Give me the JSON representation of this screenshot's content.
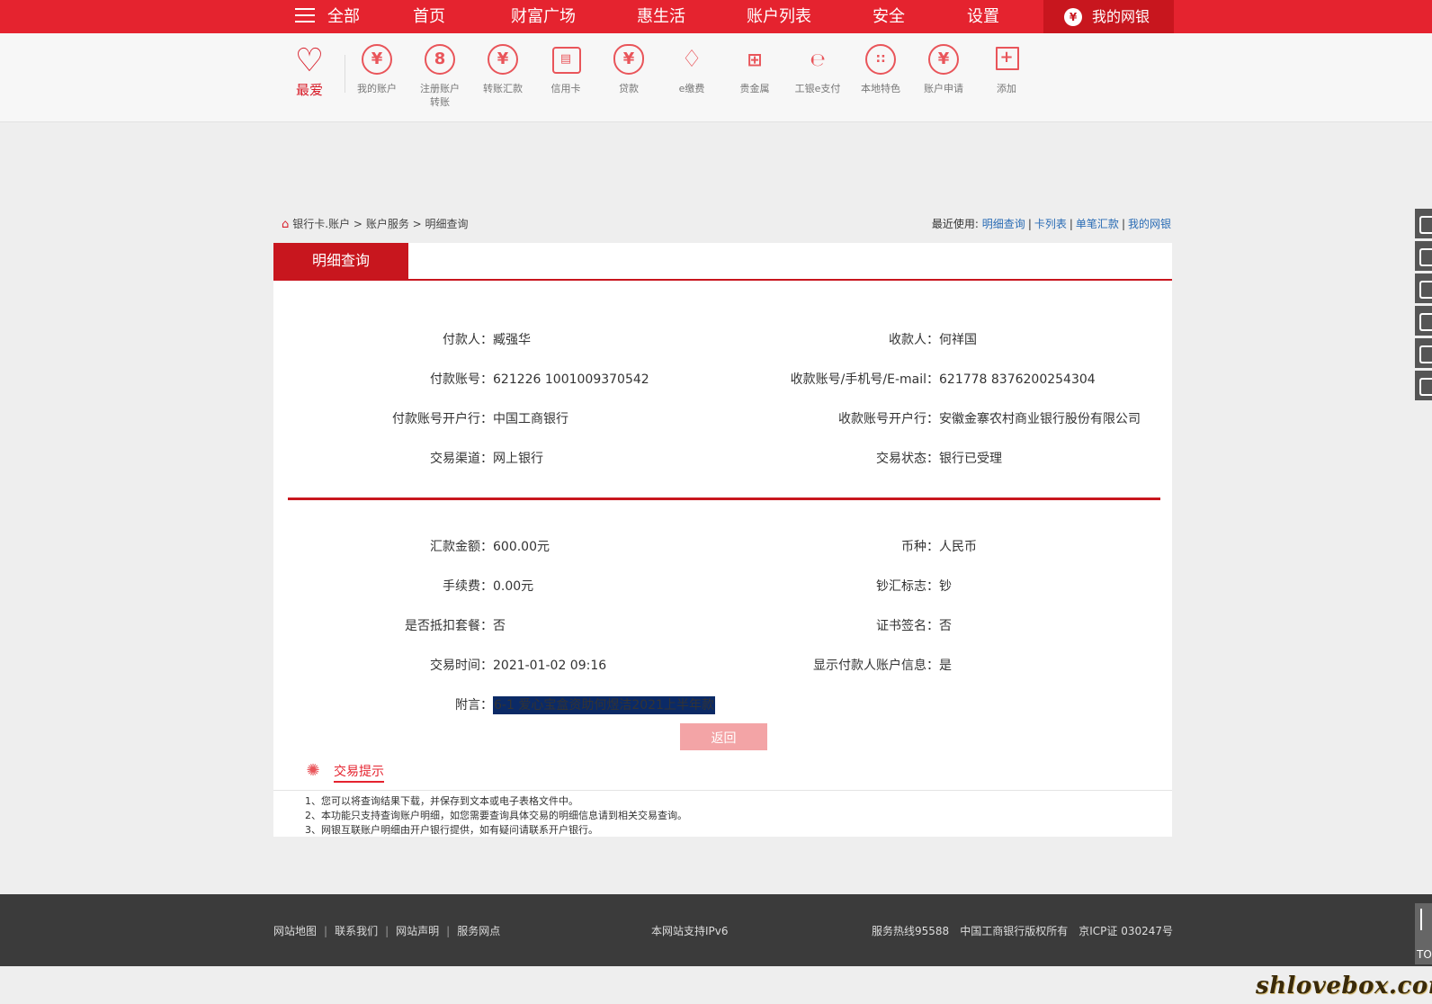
{
  "nav": {
    "all_label": "全部",
    "items": [
      "首页",
      "财富广场",
      "惠生活",
      "账户列表",
      "安全",
      "设置"
    ],
    "mybank_label": "我的网银"
  },
  "toolbar": {
    "favorite_label": "最爱",
    "items": [
      {
        "label": "我的账户",
        "icon": "yen-icon"
      },
      {
        "label": "注册账户转账",
        "icon": "refresh-icon"
      },
      {
        "label": "转账汇款",
        "icon": "transfer-icon"
      },
      {
        "label": "信用卡",
        "icon": "credit-card-icon"
      },
      {
        "label": "贷款",
        "icon": "money-bag-icon"
      },
      {
        "label": "e缴费",
        "icon": "drop-bolt-icon"
      },
      {
        "label": "贵金属",
        "icon": "gold-bars-icon"
      },
      {
        "label": "工银e支付",
        "icon": "e-pay-icon"
      },
      {
        "label": "本地特色",
        "icon": "grid-dots-icon"
      },
      {
        "label": "账户申请",
        "icon": "yen-apply-icon"
      },
      {
        "label": "添加",
        "icon": "plus-icon"
      }
    ]
  },
  "breadcrumb": {
    "items": [
      "银行卡.账户",
      "账户服务",
      "明细查询"
    ],
    "separator": ">"
  },
  "recent": {
    "label": "最近使用:",
    "links": [
      "明细查询",
      "卡列表",
      "单笔汇款",
      "我的网银"
    ]
  },
  "panel": {
    "tab_label": "明细查询",
    "section1": {
      "payer_label": "付款人：",
      "payer": "臧强华",
      "payee_label": "收款人：",
      "payee": "何祥国",
      "payer_account_label": "付款账号：",
      "payer_account": "621226 1001009370542",
      "payee_account_label": "收款账号/手机号/E-mail：",
      "payee_account": "621778 8376200254304",
      "payer_bank_label": "付款账号开户行：",
      "payer_bank": "中国工商银行",
      "payee_bank_label": "收款账号开户行：",
      "payee_bank": "安徽金寨农村商业银行股份有限公司",
      "channel_label": "交易渠道：",
      "channel": "网上银行",
      "status_label": "交易状态：",
      "status": "银行已受理"
    },
    "section2": {
      "amount_label": "汇款金额：",
      "amount": "600.00元",
      "currency_label": "币种：",
      "currency": "人民币",
      "fee_label": "手续费：",
      "fee": "0.00元",
      "cash_flag_label": "钞汇标志：",
      "cash_flag": "钞",
      "package_label": "是否抵扣套餐：",
      "package": "否",
      "cert_label": "证书签名：",
      "cert": "否",
      "time_label": "交易时间：",
      "time": "2021-01-02 09:16",
      "show_payer_label": "显示付款人账户信息：",
      "show_payer": "是",
      "remark_label": "附言：",
      "remark": "6-1 爱心宝盒资助何煜洁2021上半年款"
    },
    "back_button": "返回"
  },
  "tips": {
    "title": "交易提示",
    "lines": [
      "1、您可以将查询结果下载，并保存到文本或电子表格文件中。",
      "2、本功能只支持查询账户明细，如您需要查询具体交易的明细信息请到相关交易查询。",
      "3、网银互联账户明细由开户银行提供，如有疑问请联系开户银行。"
    ]
  },
  "footer": {
    "links": [
      "网站地图",
      "联系我们",
      "网站声明",
      "服务网点"
    ],
    "ipv6": "本网站支持IPv6",
    "hotline": "服务热线95588",
    "copyright": "中国工商银行版权所有",
    "icp": "京ICP证 030247号"
  },
  "side": {
    "top_label": "TO"
  },
  "watermark": "shlovebox.com",
  "colors": {
    "brand_red": "#e5232f",
    "dark_red": "#c8161e",
    "link_blue": "#2a6cb5"
  }
}
